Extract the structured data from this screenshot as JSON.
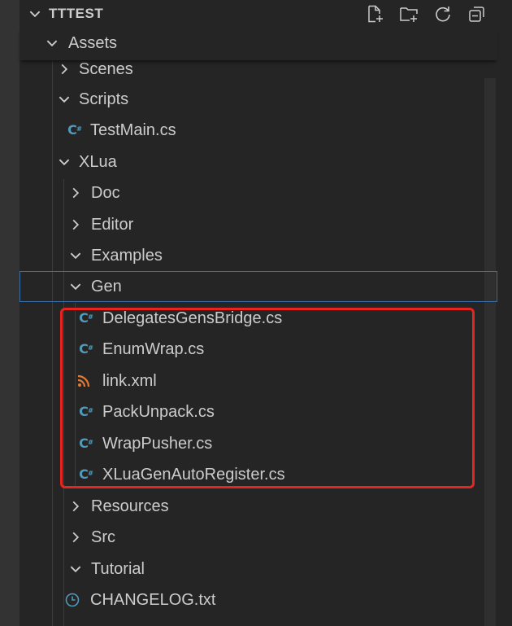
{
  "explorer": {
    "title": "TTTEST",
    "actions": [
      {
        "name": "new-file-icon"
      },
      {
        "name": "new-folder-icon"
      },
      {
        "name": "refresh-icon"
      },
      {
        "name": "collapse-all-icon"
      }
    ]
  },
  "tree": [
    {
      "label": "Assets",
      "type": "folder",
      "expanded": true
    },
    {
      "label": "Scenes",
      "type": "folder",
      "expanded": false
    },
    {
      "label": "Scripts",
      "type": "folder",
      "expanded": true
    },
    {
      "label": "TestMain.cs",
      "type": "cs"
    },
    {
      "label": "XLua",
      "type": "folder",
      "expanded": true
    },
    {
      "label": "Doc",
      "type": "folder",
      "expanded": false
    },
    {
      "label": "Editor",
      "type": "folder",
      "expanded": false
    },
    {
      "label": "Examples",
      "type": "folder",
      "expanded": true
    },
    {
      "label": "Gen",
      "type": "folder",
      "expanded": true,
      "selected": true
    },
    {
      "label": "DelegatesGensBridge.cs",
      "type": "cs"
    },
    {
      "label": "EnumWrap.cs",
      "type": "cs"
    },
    {
      "label": "link.xml",
      "type": "rss"
    },
    {
      "label": "PackUnpack.cs",
      "type": "cs"
    },
    {
      "label": "WrapPusher.cs",
      "type": "cs"
    },
    {
      "label": "XLuaGenAutoRegister.cs",
      "type": "cs"
    },
    {
      "label": "Resources",
      "type": "folder",
      "expanded": false
    },
    {
      "label": "Src",
      "type": "folder",
      "expanded": false
    },
    {
      "label": "Tutorial",
      "type": "folder",
      "expanded": true
    },
    {
      "label": "CHANGELOG.txt",
      "type": "clock"
    }
  ],
  "colors": {
    "background": "#252526",
    "text": "#cccccc",
    "csharp_icon": "#519aba",
    "rss_icon": "#e37933",
    "highlight_box": "#e8241f",
    "selection_border": "#3a6ea8"
  }
}
